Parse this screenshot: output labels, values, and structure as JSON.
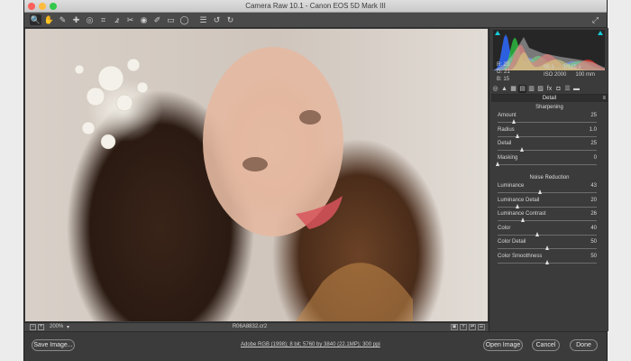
{
  "window": {
    "title": "Camera Raw 10.1  -  Canon EOS 5D Mark III"
  },
  "toolbar": {
    "tools": [
      "zoom-icon",
      "hand-icon",
      "white-balance-icon",
      "color-sampler-icon",
      "targeted-adjustment-icon",
      "crop-icon",
      "straighten-icon",
      "spot-removal-icon",
      "red-eye-icon",
      "adjustment-brush-icon",
      "graduated-filter-icon",
      "radial-filter-icon",
      "preferences-icon",
      "rotate-ccw-icon",
      "rotate-cw-icon"
    ],
    "tool_glyphs": [
      "🔍",
      "✋",
      "✎",
      "✚",
      "◎",
      "⌗",
      "⦨",
      "✂",
      "◉",
      "✐",
      "▭",
      "◯",
      "☰",
      "↺",
      "↻"
    ],
    "fullscreen_glyph": "⤢"
  },
  "preview": {
    "zoom_out": "−",
    "zoom_in": "+",
    "zoom_level": "200%",
    "zoom_arrow": "▾",
    "filename": "R06A8832.cr2",
    "view_buttons": [
      "▣",
      "Y",
      "⇄",
      "☰"
    ]
  },
  "histogram": {
    "readout": {
      "r": "R:   23",
      "g": "G:   21",
      "b": "B:   15"
    },
    "exif": {
      "aperture": "f/6.3",
      "shutter": "1/125 s",
      "iso": "ISO 2000",
      "focal": "100 mm"
    },
    "colors": {
      "red": "#ff3b30",
      "green": "#2ecc40",
      "blue": "#2f6bff",
      "yellow": "#f7e43b",
      "warning": "#16c9d8"
    }
  },
  "panel": {
    "tabs": [
      "◎",
      "▲",
      "▦",
      "▤",
      "▥",
      "▨",
      "fx",
      "◘",
      "☰",
      "▬"
    ],
    "active_tab_index": 3,
    "header": "Detail",
    "menu_glyph": "≡",
    "sharpening": {
      "title": "Sharpening",
      "sliders": [
        {
          "label": "Amount",
          "value": "25",
          "pos": 0.17
        },
        {
          "label": "Radius",
          "value": "1.0",
          "pos": 0.2
        },
        {
          "label": "Detail",
          "value": "25",
          "pos": 0.25
        },
        {
          "label": "Masking",
          "value": "0",
          "pos": 0.0
        }
      ]
    },
    "noise_reduction": {
      "title": "Noise Reduction",
      "sliders": [
        {
          "label": "Luminance",
          "value": "43",
          "pos": 0.43
        },
        {
          "label": "Luminance Detail",
          "value": "20",
          "pos": 0.2
        },
        {
          "label": "Luminance Contrast",
          "value": "26",
          "pos": 0.26
        },
        {
          "label": "Color",
          "value": "40",
          "pos": 0.4
        },
        {
          "label": "Color Detail",
          "value": "50",
          "pos": 0.5
        },
        {
          "label": "Color Smoothness",
          "value": "50",
          "pos": 0.5
        }
      ]
    }
  },
  "footer": {
    "save_label": "Save Image...",
    "workflow": "Adobe RGB (1998); 8 bit; 5760 by 3840 (22.1MP); 300 ppi",
    "open_label": "Open Image",
    "cancel_label": "Cancel",
    "done_label": "Done"
  }
}
